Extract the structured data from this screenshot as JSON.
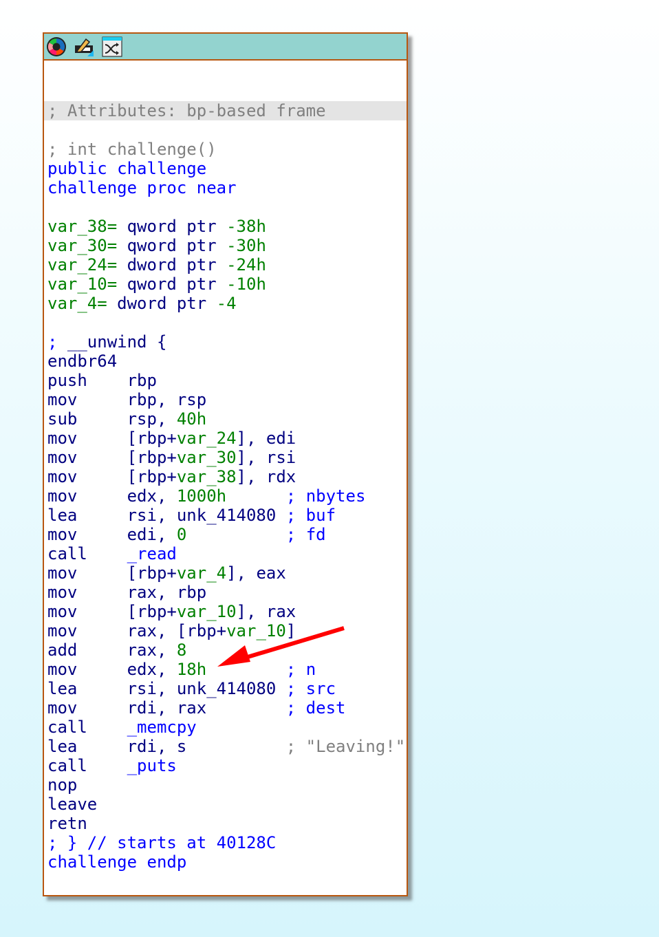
{
  "toolbar": {
    "icons": [
      "color-palette-icon",
      "edit-rename-icon",
      "graph-layout-icon"
    ]
  },
  "colors": {
    "mnemonic": "#000080",
    "number": "#008000",
    "name": "#0000ff",
    "comment": "#808080",
    "node_border": "#b8560f",
    "header": "#93d3cf",
    "arrow": "#ff0000"
  },
  "lines": [
    {
      "t": []
    },
    {
      "t": []
    },
    {
      "hl": true,
      "t": [
        {
          "s": "; Attributes: bp-based frame",
          "c": "c"
        }
      ]
    },
    {
      "t": []
    },
    {
      "t": [
        {
          "s": "; int challenge()",
          "c": "c"
        }
      ]
    },
    {
      "t": [
        {
          "s": "public challenge",
          "c": "b"
        }
      ]
    },
    {
      "t": [
        {
          "s": "challenge proc near",
          "c": "b"
        }
      ]
    },
    {
      "t": []
    },
    {
      "t": [
        {
          "s": "var_38=",
          "c": "g"
        },
        {
          "s": " qword ptr ",
          "c": "n"
        },
        {
          "s": "-38h",
          "c": "g"
        }
      ]
    },
    {
      "t": [
        {
          "s": "var_30=",
          "c": "g"
        },
        {
          "s": " qword ptr ",
          "c": "n"
        },
        {
          "s": "-30h",
          "c": "g"
        }
      ]
    },
    {
      "t": [
        {
          "s": "var_24=",
          "c": "g"
        },
        {
          "s": " dword ptr ",
          "c": "n"
        },
        {
          "s": "-24h",
          "c": "g"
        }
      ]
    },
    {
      "t": [
        {
          "s": "var_10=",
          "c": "g"
        },
        {
          "s": " qword ptr ",
          "c": "n"
        },
        {
          "s": "-10h",
          "c": "g"
        }
      ]
    },
    {
      "t": [
        {
          "s": "var_4=",
          "c": "g"
        },
        {
          "s": " dword ptr ",
          "c": "n"
        },
        {
          "s": "-4",
          "c": "g"
        }
      ]
    },
    {
      "t": []
    },
    {
      "t": [
        {
          "s": ";",
          "c": "b"
        },
        {
          "s": " __unwind {",
          "c": "n"
        }
      ]
    },
    {
      "t": [
        {
          "s": "endbr64",
          "c": "n"
        }
      ]
    },
    {
      "t": [
        {
          "s": "push    rbp",
          "c": "n"
        }
      ]
    },
    {
      "t": [
        {
          "s": "mov     rbp, rsp",
          "c": "n"
        }
      ]
    },
    {
      "t": [
        {
          "s": "sub     rsp, ",
          "c": "n"
        },
        {
          "s": "40h",
          "c": "g"
        }
      ]
    },
    {
      "t": [
        {
          "s": "mov     [rbp+",
          "c": "n"
        },
        {
          "s": "var_24",
          "c": "g"
        },
        {
          "s": "], edi",
          "c": "n"
        }
      ]
    },
    {
      "t": [
        {
          "s": "mov     [rbp+",
          "c": "n"
        },
        {
          "s": "var_30",
          "c": "g"
        },
        {
          "s": "], rsi",
          "c": "n"
        }
      ]
    },
    {
      "t": [
        {
          "s": "mov     [rbp+",
          "c": "n"
        },
        {
          "s": "var_38",
          "c": "g"
        },
        {
          "s": "], rdx",
          "c": "n"
        }
      ]
    },
    {
      "t": [
        {
          "s": "mov     edx, ",
          "c": "n"
        },
        {
          "s": "1000h",
          "c": "g"
        },
        {
          "s": "      ",
          "c": "n"
        },
        {
          "s": "; nbytes",
          "c": "b"
        }
      ]
    },
    {
      "t": [
        {
          "s": "lea     rsi, unk_414080 ",
          "c": "n"
        },
        {
          "s": "; buf",
          "c": "b"
        }
      ]
    },
    {
      "t": [
        {
          "s": "mov     edi, ",
          "c": "n"
        },
        {
          "s": "0",
          "c": "g"
        },
        {
          "s": "          ",
          "c": "n"
        },
        {
          "s": "; fd",
          "c": "b"
        }
      ]
    },
    {
      "t": [
        {
          "s": "call    ",
          "c": "n"
        },
        {
          "s": "_read",
          "c": "b"
        }
      ]
    },
    {
      "t": [
        {
          "s": "mov     [rbp+",
          "c": "n"
        },
        {
          "s": "var_4",
          "c": "g"
        },
        {
          "s": "], eax",
          "c": "n"
        }
      ]
    },
    {
      "t": [
        {
          "s": "mov     rax, rbp",
          "c": "n"
        }
      ]
    },
    {
      "t": [
        {
          "s": "mov     [rbp+",
          "c": "n"
        },
        {
          "s": "var_10",
          "c": "g"
        },
        {
          "s": "], rax",
          "c": "n"
        }
      ]
    },
    {
      "t": [
        {
          "s": "mov     rax, [rbp+",
          "c": "n"
        },
        {
          "s": "var_10",
          "c": "g"
        },
        {
          "s": "]",
          "c": "n"
        }
      ]
    },
    {
      "t": [
        {
          "s": "add     rax, ",
          "c": "n"
        },
        {
          "s": "8",
          "c": "g"
        }
      ]
    },
    {
      "t": [
        {
          "s": "mov     edx, ",
          "c": "n"
        },
        {
          "s": "18h",
          "c": "g"
        },
        {
          "s": "        ",
          "c": "n"
        },
        {
          "s": "; n",
          "c": "b"
        }
      ]
    },
    {
      "t": [
        {
          "s": "lea     rsi, unk_414080 ",
          "c": "n"
        },
        {
          "s": "; src",
          "c": "b"
        }
      ]
    },
    {
      "t": [
        {
          "s": "mov     rdi, rax        ",
          "c": "n"
        },
        {
          "s": "; dest",
          "c": "b"
        }
      ]
    },
    {
      "t": [
        {
          "s": "call    ",
          "c": "n"
        },
        {
          "s": "_memcpy",
          "c": "b"
        }
      ]
    },
    {
      "t": [
        {
          "s": "lea     rdi, s          ",
          "c": "n"
        },
        {
          "s": "; \"Leaving!\"",
          "c": "c"
        }
      ]
    },
    {
      "t": [
        {
          "s": "call    ",
          "c": "n"
        },
        {
          "s": "_puts",
          "c": "b"
        }
      ]
    },
    {
      "t": [
        {
          "s": "nop",
          "c": "n"
        }
      ]
    },
    {
      "t": [
        {
          "s": "leave",
          "c": "n"
        }
      ]
    },
    {
      "t": [
        {
          "s": "retn",
          "c": "n"
        }
      ]
    },
    {
      "t": [
        {
          "s": "; } // starts at 40128C",
          "c": "b"
        }
      ]
    },
    {
      "t": [
        {
          "s": "challenge endp",
          "c": "b"
        }
      ]
    }
  ]
}
